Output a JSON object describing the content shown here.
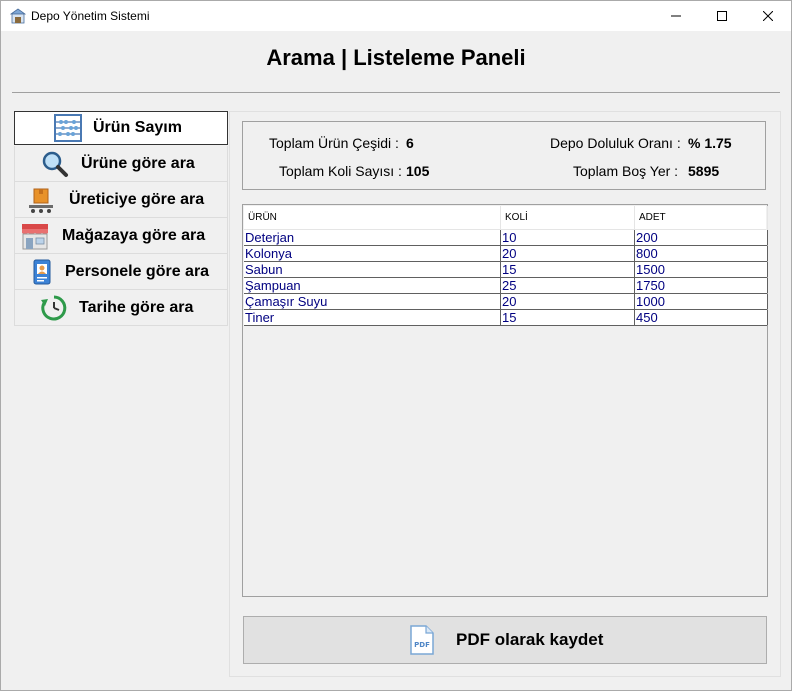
{
  "window": {
    "title": "Depo Yönetim Sistemi",
    "controls": [
      "minimize",
      "maximize",
      "close"
    ]
  },
  "header": {
    "title": "Arama | Listeleme Paneli"
  },
  "sidebar": {
    "items": [
      {
        "label": "Ürün Sayım",
        "icon": "abacus-icon",
        "active": true
      },
      {
        "label": "Ürüne göre ara",
        "icon": "magnifier-icon",
        "active": false
      },
      {
        "label": "Üreticiye göre ara",
        "icon": "conveyor-box-icon",
        "active": false
      },
      {
        "label": "Mağazaya göre ara",
        "icon": "storefront-icon",
        "active": false
      },
      {
        "label": "Personele göre ara",
        "icon": "id-badge-icon",
        "active": false
      },
      {
        "label": "Tarihe göre ara",
        "icon": "clock-icon",
        "active": false
      }
    ]
  },
  "stats": {
    "product_types_label": "Toplam Ürün Çeşidi :",
    "product_types_value": "6",
    "box_count_label": "Toplam Koli Sayısı :",
    "box_count_value": "105",
    "occupancy_label": "Depo Doluluk Oranı :",
    "occupancy_value": "% 1.75",
    "empty_space_label": "Toplam Boş Yer :",
    "empty_space_value": "5895"
  },
  "table": {
    "columns": [
      "ÜRÜN",
      "KOLİ",
      "ADET"
    ],
    "rows": [
      [
        "Deterjan",
        "10",
        "200"
      ],
      [
        "Kolonya",
        "20",
        "800"
      ],
      [
        "Sabun",
        "15",
        "1500"
      ],
      [
        "Şampuan",
        "25",
        "1750"
      ],
      [
        "Çamaşır Suyu",
        "20",
        "1000"
      ],
      [
        "Tiner",
        "15",
        "450"
      ]
    ]
  },
  "actions": {
    "pdf_label": "PDF olarak kaydet",
    "pdf_icon": "pdf-file-icon"
  },
  "colors": {
    "table_text": "#000080",
    "background": "#f0f0f0"
  }
}
